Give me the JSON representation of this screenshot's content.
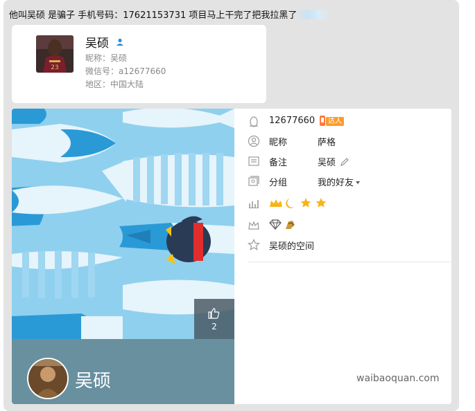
{
  "message": {
    "text": "他叫吴硕 是骗子 手机号码：17621153731  项目马上干完了把我拉黑了"
  },
  "contact_card": {
    "name": "吴硕",
    "nickname_line": "昵称：吴硕",
    "wechat_line": "微信号：a12677660",
    "region_line": "地区：中国大陆"
  },
  "qq_profile": {
    "like_count": "2",
    "display_name": "吴硕",
    "qq_number": "12677660",
    "talent_badge": "达人",
    "rows": {
      "nickname_label": "昵称",
      "nickname_value": "萨格",
      "remark_label": "备注",
      "remark_value": "吴硕",
      "group_label": "分组",
      "group_value": "我的好友",
      "space_label": "吴硕的空间"
    },
    "watermark": "waibaoquan.com"
  },
  "icons": [
    "penguin-icon",
    "person-icon",
    "remark-card-icon",
    "group-icon",
    "level-chart-icon",
    "vip-crown-icon",
    "star-icon",
    "edit-pencil-icon",
    "dropdown-arrow-icon",
    "thumbs-up-icon"
  ],
  "colors": {
    "cover_bg": "#8fd0ef",
    "fish_dark": "#2a9ad6",
    "bottom_band": "#69909f",
    "link_blue": "#2a8fd6"
  }
}
